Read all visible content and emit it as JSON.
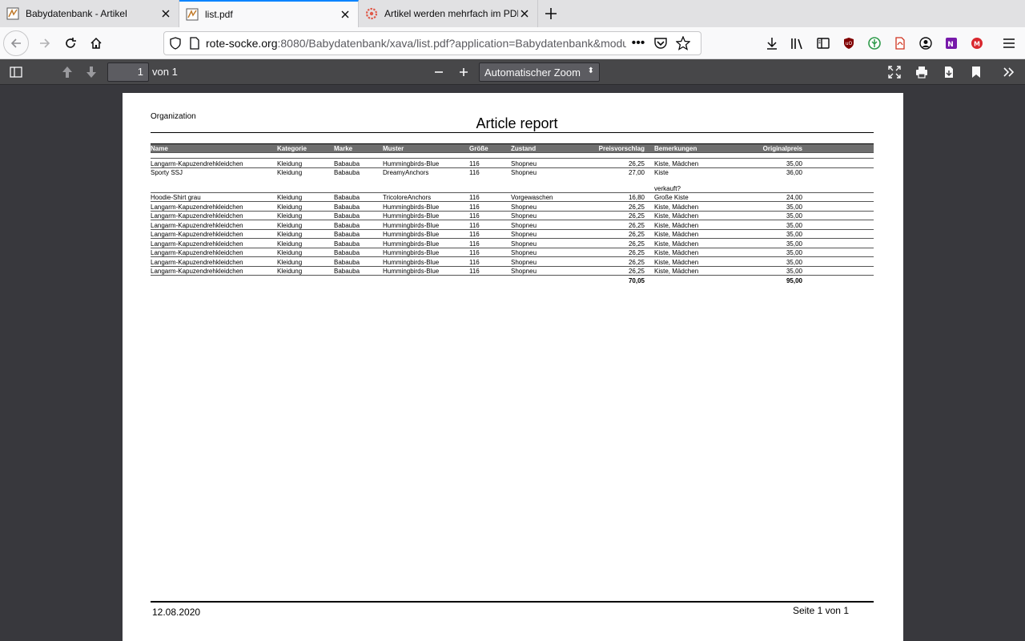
{
  "tabs": [
    {
      "title": "Babydatenbank - Artikel",
      "active": false
    },
    {
      "title": "list.pdf",
      "active": true
    },
    {
      "title": "Artikel werden mehrfach im PDF",
      "active": false
    }
  ],
  "nav": {
    "url_domain": "rote-socke.org",
    "url_rest": ":8080/Babydatenbank/xava/list.pdf?application=Babydatenbank&module=Artikel"
  },
  "pdf_toolbar": {
    "page_number": "1",
    "page_of": "von 1",
    "zoom": "Automatischer Zoom"
  },
  "report": {
    "organization": "Organization",
    "title": "Article report",
    "columns": [
      "Name",
      "Kategorie",
      "Marke",
      "Muster",
      "Größe",
      "Zustand",
      "Preisvorschlag",
      "Bemerkungen",
      "Originalpreis"
    ],
    "rows": [
      {
        "name": "Langarm-Kapuzendrehkleidchen",
        "kat": "Kleidung",
        "marke": "Babauba",
        "muster": "Hummingbirds-Blue",
        "gr": "116",
        "zu": "Shopneu",
        "pv": "26,25",
        "bem": "Kiste, Mädchen",
        "bem2": "",
        "op": "35,00"
      },
      {
        "name": "Sporty SSJ",
        "kat": "Kleidung",
        "marke": "Babauba",
        "muster": "DreamyAnchors",
        "gr": "116",
        "zu": "Shopneu",
        "pv": "27,00",
        "bem": "Kiste",
        "bem2": "verkauft?",
        "op": "36,00"
      },
      {
        "name": "Hoodie-Shirt grau",
        "kat": "Kleidung",
        "marke": "Babauba",
        "muster": "TricoloreAnchors",
        "gr": "116",
        "zu": "Vorgewaschen",
        "pv": "16,80",
        "bem": "Große Kiste",
        "bem2": "",
        "op": "24,00"
      },
      {
        "name": "Langarm-Kapuzendrehkleidchen",
        "kat": "Kleidung",
        "marke": "Babauba",
        "muster": "Hummingbirds-Blue",
        "gr": "116",
        "zu": "Shopneu",
        "pv": "26,25",
        "bem": "Kiste, Mädchen",
        "bem2": "",
        "op": "35,00"
      },
      {
        "name": "Langarm-Kapuzendrehkleidchen",
        "kat": "Kleidung",
        "marke": "Babauba",
        "muster": "Hummingbirds-Blue",
        "gr": "116",
        "zu": "Shopneu",
        "pv": "26,25",
        "bem": "Kiste, Mädchen",
        "bem2": "",
        "op": "35,00"
      },
      {
        "name": "Langarm-Kapuzendrehkleidchen",
        "kat": "Kleidung",
        "marke": "Babauba",
        "muster": "Hummingbirds-Blue",
        "gr": "116",
        "zu": "Shopneu",
        "pv": "26,25",
        "bem": "Kiste, Mädchen",
        "bem2": "",
        "op": "35,00"
      },
      {
        "name": "Langarm-Kapuzendrehkleidchen",
        "kat": "Kleidung",
        "marke": "Babauba",
        "muster": "Hummingbirds-Blue",
        "gr": "116",
        "zu": "Shopneu",
        "pv": "26,25",
        "bem": "Kiste, Mädchen",
        "bem2": "",
        "op": "35,00"
      },
      {
        "name": "Langarm-Kapuzendrehkleidchen",
        "kat": "Kleidung",
        "marke": "Babauba",
        "muster": "Hummingbirds-Blue",
        "gr": "116",
        "zu": "Shopneu",
        "pv": "26,25",
        "bem": "Kiste, Mädchen",
        "bem2": "",
        "op": "35,00"
      },
      {
        "name": "Langarm-Kapuzendrehkleidchen",
        "kat": "Kleidung",
        "marke": "Babauba",
        "muster": "Hummingbirds-Blue",
        "gr": "116",
        "zu": "Shopneu",
        "pv": "26,25",
        "bem": "Kiste, Mädchen",
        "bem2": "",
        "op": "35,00"
      },
      {
        "name": "Langarm-Kapuzendrehkleidchen",
        "kat": "Kleidung",
        "marke": "Babauba",
        "muster": "Hummingbirds-Blue",
        "gr": "116",
        "zu": "Shopneu",
        "pv": "26,25",
        "bem": "Kiste, Mädchen",
        "bem2": "",
        "op": "35,00"
      },
      {
        "name": "Langarm-Kapuzendrehkleidchen",
        "kat": "Kleidung",
        "marke": "Babauba",
        "muster": "Hummingbirds-Blue",
        "gr": "116",
        "zu": "Shopneu",
        "pv": "26,25",
        "bem": "Kiste, Mädchen",
        "bem2": "",
        "op": "35,00"
      }
    ],
    "total_preisvorschlag": "70,05",
    "total_originalpreis": "95,00",
    "footer_date": "12.08.2020",
    "footer_page": "Seite 1 von 1"
  },
  "colors": {
    "accent": "#0a84ff",
    "pdf_toolbar": "#474749",
    "viewer_bg": "#38383d",
    "header_band": "#6e6e6e"
  },
  "icons": {
    "ublock": "#800000",
    "onenote": "#7719aa",
    "mega": "#d9272e"
  }
}
